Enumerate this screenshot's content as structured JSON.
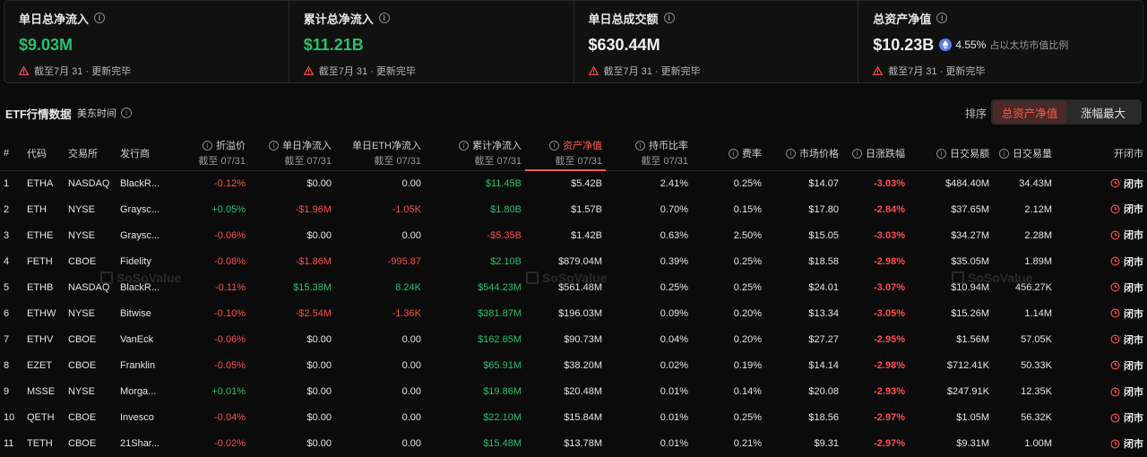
{
  "cards": [
    {
      "title": "单日总净流入",
      "value": "$9.03M",
      "value_color": "#25c36b",
      "note": "截至7月 31 · 更新完毕"
    },
    {
      "title": "累计总净流入",
      "value": "$11.21B",
      "value_color": "#25c36b",
      "note": "截至7月 31 · 更新完毕"
    },
    {
      "title": "单日总成交额",
      "value": "$630.44M",
      "value_color": "#f2f2f2",
      "note": "截至7月 31 · 更新完毕"
    },
    {
      "title": "总资产净值",
      "value": "$10.23B",
      "value_color": "#f2f2f2",
      "sub_value": "4.55%",
      "sub_label": "占以太坊市值比例",
      "note": "截至7月 31 · 更新完毕"
    }
  ],
  "bar": {
    "title": "ETF行情数据",
    "timezone": "美东时间",
    "sort_label": "排序",
    "sort_options": [
      "总资产净值",
      "涨幅最大"
    ],
    "sort_active": 0
  },
  "watermark": "SoSoValue",
  "columns": {
    "idx": "#",
    "code": "代码",
    "exchange": "交易所",
    "issuer": "发行商",
    "premium": "折溢价",
    "premium_sub": "截至 07/31",
    "daily_flow": "单日净流入",
    "daily_flow_sub": "截至 07/31",
    "daily_eth_flow": "单日ETH净流入",
    "daily_eth_flow_sub": "截至 07/31",
    "cum_flow": "累计净流入",
    "cum_flow_sub": "截至 07/31",
    "nav": "资产净值",
    "nav_sub": "截至 07/31",
    "hold_ratio": "持币比率",
    "hold_ratio_sub": "截至 07/31",
    "fee": "费率",
    "price": "市场价格",
    "change": "日涨跌幅",
    "turnover": "日交易额",
    "volume": "日交易量",
    "status": "开闭市"
  },
  "rows": [
    {
      "idx": "1",
      "code": "ETHA",
      "exchange": "NASDAQ",
      "issuer": "BlackR...",
      "premium": "-0.12%",
      "daily_flow": "$0.00",
      "daily_eth_flow": "0.00",
      "cum_flow": "$11.45B",
      "nav": "$5.42B",
      "hold_ratio": "2.41%",
      "fee": "0.25%",
      "price": "$14.07",
      "change": "-3.03%",
      "turnover": "$484.40M",
      "volume": "34.43M",
      "status": "闭市"
    },
    {
      "idx": "2",
      "code": "ETH",
      "exchange": "NYSE",
      "issuer": "Graysc...",
      "premium": "+0.05%",
      "daily_flow": "-$1.96M",
      "daily_eth_flow": "-1.05K",
      "cum_flow": "$1.80B",
      "nav": "$1.57B",
      "hold_ratio": "0.70%",
      "fee": "0.15%",
      "price": "$17.80",
      "change": "-2.84%",
      "turnover": "$37.65M",
      "volume": "2.12M",
      "status": "闭市"
    },
    {
      "idx": "3",
      "code": "ETHE",
      "exchange": "NYSE",
      "issuer": "Graysc...",
      "premium": "-0.06%",
      "daily_flow": "$0.00",
      "daily_eth_flow": "0.00",
      "cum_flow": "-$5.35B",
      "nav": "$1.42B",
      "hold_ratio": "0.63%",
      "fee": "2.50%",
      "price": "$15.05",
      "change": "-3.03%",
      "turnover": "$34.27M",
      "volume": "2.28M",
      "status": "闭市"
    },
    {
      "idx": "4",
      "code": "FETH",
      "exchange": "CBOE",
      "issuer": "Fidelity",
      "premium": "-0.08%",
      "daily_flow": "-$1.86M",
      "daily_eth_flow": "-995.87",
      "cum_flow": "$2.10B",
      "nav": "$879.04M",
      "hold_ratio": "0.39%",
      "fee": "0.25%",
      "price": "$18.58",
      "change": "-2.98%",
      "turnover": "$35.05M",
      "volume": "1.89M",
      "status": "闭市"
    },
    {
      "idx": "5",
      "code": "ETHB",
      "exchange": "NASDAQ",
      "issuer": "BlackR...",
      "premium": "-0.11%",
      "daily_flow": "$15.38M",
      "daily_eth_flow": "8.24K",
      "cum_flow": "$544.23M",
      "nav": "$561.48M",
      "hold_ratio": "0.25%",
      "fee": "0.25%",
      "price": "$24.01",
      "change": "-3.07%",
      "turnover": "$10.94M",
      "volume": "456.27K",
      "status": "闭市"
    },
    {
      "idx": "6",
      "code": "ETHW",
      "exchange": "NYSE",
      "issuer": "Bitwise",
      "premium": "-0.10%",
      "daily_flow": "-$2.54M",
      "daily_eth_flow": "-1.36K",
      "cum_flow": "$381.87M",
      "nav": "$196.03M",
      "hold_ratio": "0.09%",
      "fee": "0.20%",
      "price": "$13.34",
      "change": "-3.05%",
      "turnover": "$15.26M",
      "volume": "1.14M",
      "status": "闭市"
    },
    {
      "idx": "7",
      "code": "ETHV",
      "exchange": "CBOE",
      "issuer": "VanEck",
      "premium": "-0.06%",
      "daily_flow": "$0.00",
      "daily_eth_flow": "0.00",
      "cum_flow": "$162.65M",
      "nav": "$90.73M",
      "hold_ratio": "0.04%",
      "fee": "0.20%",
      "price": "$27.27",
      "change": "-2.95%",
      "turnover": "$1.56M",
      "volume": "57.05K",
      "status": "闭市"
    },
    {
      "idx": "8",
      "code": "EZET",
      "exchange": "CBOE",
      "issuer": "Franklin",
      "premium": "-0.05%",
      "daily_flow": "$0.00",
      "daily_eth_flow": "0.00",
      "cum_flow": "$65.91M",
      "nav": "$38.20M",
      "hold_ratio": "0.02%",
      "fee": "0.19%",
      "price": "$14.14",
      "change": "-2.98%",
      "turnover": "$712.41K",
      "volume": "50.33K",
      "status": "闭市"
    },
    {
      "idx": "9",
      "code": "MSSE",
      "exchange": "NYSE",
      "issuer": "Morga...",
      "premium": "+0.01%",
      "daily_flow": "$0.00",
      "daily_eth_flow": "0.00",
      "cum_flow": "$19.86M",
      "nav": "$20.48M",
      "hold_ratio": "0.01%",
      "fee": "0.14%",
      "price": "$20.08",
      "change": "-2.93%",
      "turnover": "$247.91K",
      "volume": "12.35K",
      "status": "闭市"
    },
    {
      "idx": "10",
      "code": "QETH",
      "exchange": "CBOE",
      "issuer": "Invesco",
      "premium": "-0.04%",
      "daily_flow": "$0.00",
      "daily_eth_flow": "0.00",
      "cum_flow": "$22.10M",
      "nav": "$15.84M",
      "hold_ratio": "0.01%",
      "fee": "0.25%",
      "price": "$18.56",
      "change": "-2.97%",
      "turnover": "$1.05M",
      "volume": "56.32K",
      "status": "闭市"
    },
    {
      "idx": "11",
      "code": "TETH",
      "exchange": "CBOE",
      "issuer": "21Shar...",
      "premium": "-0.02%",
      "daily_flow": "$0.00",
      "daily_eth_flow": "0.00",
      "cum_flow": "$15.48M",
      "nav": "$13.78M",
      "hold_ratio": "0.01%",
      "fee": "0.21%",
      "price": "$9.31",
      "change": "-2.97%",
      "turnover": "$9.31M",
      "volume": "1.00M",
      "status": "闭市"
    }
  ],
  "colors": {
    "positive": "#25c36b",
    "negative": "#ff4d4f",
    "accent": "#ff5a4a",
    "background": "#0b0b0b"
  }
}
